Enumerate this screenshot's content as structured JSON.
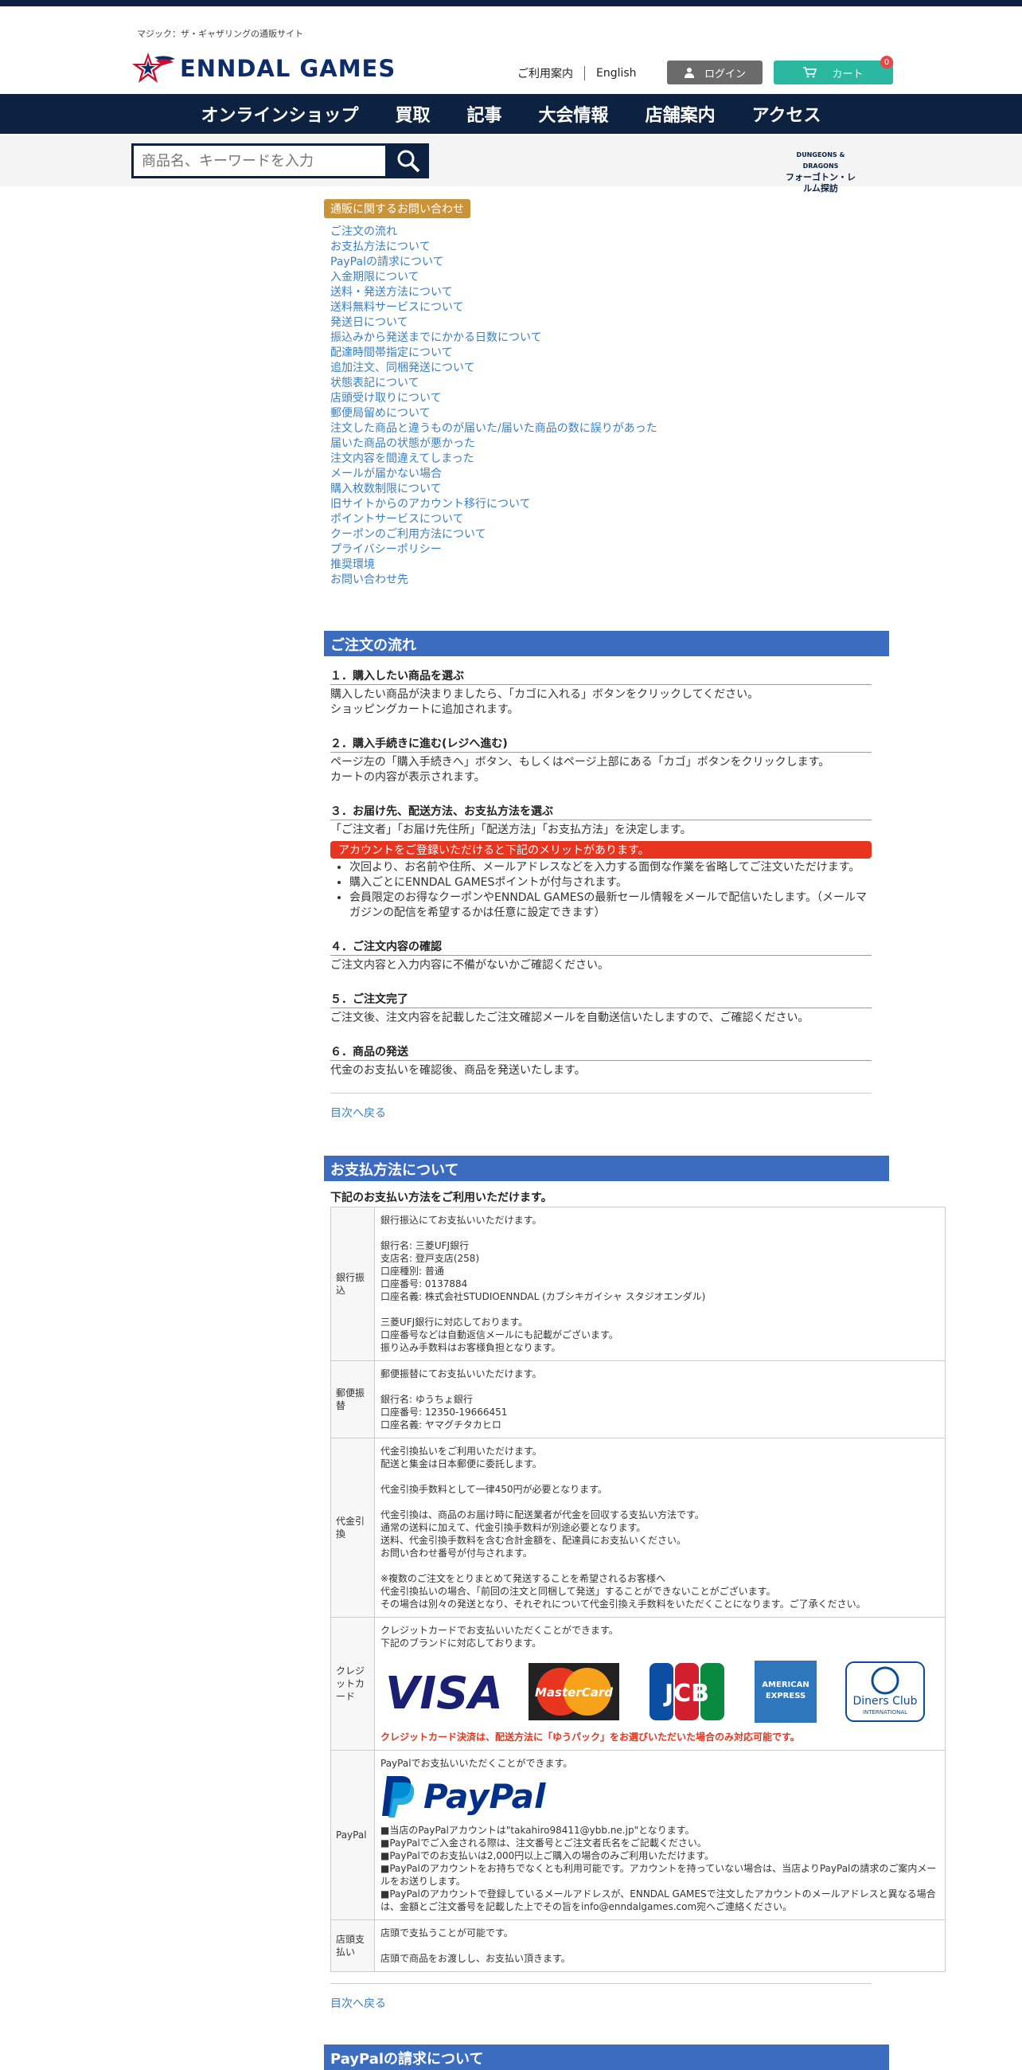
{
  "header": {
    "tagline": "マジック：ザ・ギャザリングの通販サイト",
    "logo_text": "ENNDAL GAMES",
    "links": [
      "ご利用案内",
      "English"
    ],
    "login_label": "ログイン",
    "cart_label": "カート",
    "cart_count": "0"
  },
  "nav": [
    "オンラインショップ",
    "買取",
    "記事",
    "大会情報",
    "店舗案内",
    "アクセス"
  ],
  "search": {
    "placeholder": "商品名、キーワードを入力"
  },
  "banner": {
    "top": "DUNGEONS & DRAGONS",
    "bottom": "フォーゴトン・レルム探訪"
  },
  "faq": {
    "tag": "通販に関するお問い合わせ",
    "toc": [
      "ご注文の流れ",
      "お支払方法について",
      "PayPalの請求について",
      "入金期限について",
      "送料・発送方法について",
      "送料無料サービスについて",
      "発送日について",
      "振込みから発送までにかかる日数について",
      "配達時間帯指定について",
      "追加注文、同梱発送について",
      "状態表記について",
      "店頭受け取りについて",
      "郵便局留めについて",
      "注文した商品と違うものが届いた/届いた商品の数に誤りがあった",
      "届いた商品の状態が悪かった",
      "注文内容を間違えてしまった",
      "メールが届かない場合",
      "購入枚数制限について",
      "旧サイトからのアカウント移行について",
      "ポイントサービスについて",
      "クーポンのご利用方法について",
      "プライバシーポリシー",
      "推奨環境",
      "お問い合わせ先"
    ]
  },
  "order_flow": {
    "title": "ご注文の流れ",
    "steps": [
      {
        "title": "１．購入したい商品を選ぶ",
        "lines": [
          "購入したい商品が決まりましたら、「カゴに入れる」ボタンをクリックしてください。",
          "ショッピングカートに追加されます。"
        ]
      },
      {
        "title": "２．購入手続きに進む(レジへ進む)",
        "lines": [
          "ページ左の「購入手続きへ」ボタン、もしくはページ上部にある「カゴ」ボタンをクリックします。",
          "カートの内容が表示されます。"
        ]
      },
      {
        "title": "３．お届け先、配送方法、お支払方法を選ぶ",
        "lines": [
          "「ご注文者」「お届け先住所」「配送方法」「お支払方法」を決定します。"
        ]
      },
      {
        "title": "４．ご注文内容の確認",
        "lines": [
          "ご注文内容と入力内容に不備がないかご確認ください。"
        ]
      },
      {
        "title": "５．ご注文完了",
        "lines": [
          "ご注文後、注文内容を記載したご注文確認メールを自動送信いたしますので、ご確認ください。"
        ]
      },
      {
        "title": "６．商品の発送",
        "lines": [
          "代金のお支払いを確認後、商品を発送いたします。"
        ]
      }
    ],
    "notice": "アカウントをご登録いただけると下記のメリットがあります。",
    "merits": [
      "次回より、お名前や住所、メールアドレスなどを入力する面倒な作業を省略してご注文いただけます。",
      "購入ごとにENNDAL GAMESポイントが付与されます。",
      "会員限定のお得なクーポンやENNDAL GAMESの最新セール情報をメールで配信いたします。（メールマガジンの配信を希望するかは任意に設定できます）"
    ],
    "back": "目次へ戻る"
  },
  "payment": {
    "title": "お支払方法について",
    "intro": "下記のお支払い方法をご利用いただけます。",
    "bank": {
      "label": "銀行振込",
      "lines": [
        "銀行振込にてお支払いいただけます。",
        "",
        "銀行名: 三菱UFJ銀行",
        "支店名: 登戸支店(258)",
        "口座種別: 普通",
        "口座番号: 0137884",
        "口座名義: 株式会社STUDIOENNDAL (カブシキガイシャ スタジオエンダル)",
        "",
        "三菱UFJ銀行に対応しております。",
        "口座番号などは自動返信メールにも記載がございます。",
        "振り込み手数料はお客様負担となります。"
      ]
    },
    "postal": {
      "label": "郵便振替",
      "lines": [
        "郵便振替にてお支払いいただけます。",
        "",
        "銀行名: ゆうちょ銀行",
        "口座番号: 12350-19666451",
        "口座名義: ヤマグチタカヒロ"
      ]
    },
    "cod": {
      "label": "代金引換",
      "lines": [
        "代金引換払いをご利用いただけます。",
        "配送と集金は日本郵便に委託します。",
        "",
        "代金引換手数料として一律450円が必要となります。",
        "",
        "代金引換は、商品のお届け時に配送業者が代金を回収する支払い方法です。",
        "通常の送料に加えて、代金引換手数料が別途必要となります。",
        "送料、代金引換手数料を含む合計金額を、配達員にお支払いください。",
        "お問い合わせ番号が付与されます。",
        "",
        "※複数のご注文をとりまとめて発送することを希望されるお客様へ",
        "代金引換払いの場合、「前回の注文と同梱して発送」することができないことがございます。",
        "その場合は別々の発送となり、それぞれについて代金引換え手数料をいただくことになります。ご了承ください。"
      ]
    },
    "credit": {
      "label": "クレジットカード",
      "lines": [
        "クレジットカードでお支払いいただくことができます。",
        "下記のブランドに対応しております。"
      ],
      "brands": [
        "VISA",
        "MasterCard",
        "JCB",
        "AMERICAN EXPRESS",
        "Diners Club"
      ],
      "diners_sub": "INTERNATIONAL",
      "warning": "クレジットカード決済は、配送方法に「ゆうパック」をお選びいただいた場合のみ対応可能です。"
    },
    "paypal": {
      "label": "PayPal",
      "intro": "PayPalでお支払いいただくことができます。",
      "logo_text": "PayPal",
      "lines": [
        "■当店のPayPalアカウントは\"takahiro98411@ybb.ne.jp\"となります。",
        "■PayPalでご入金される際は、注文番号とご注文者氏名をご記載ください。",
        "■PayPalでのお支払いは2,000円以上ご購入の場合のみご利用いただけます。",
        "■PayPalのアカウントをお持ちでなくとも利用可能です。アカウントを持っていない場合は、当店よりPayPalの請求のご案内メールをお送りします。",
        "■PayPalのアカウントで登録しているメールアドレスが、ENNDAL GAMESで注文したアカウントのメールアドレスと異なる場合は、金額とご注文番号を記載した上でその旨をinfo@enndalgames.com宛へご連絡ください。"
      ]
    },
    "store": {
      "label": "店頭支払い",
      "lines": [
        "店頭で支払うことが可能です。",
        "",
        "店頭で商品をお渡しし、お支払い頂きます。"
      ]
    },
    "back": "目次へ戻る"
  },
  "next_section": {
    "title": "PayPalの請求について"
  },
  "colors": {
    "navy": "#0d2240",
    "accent_teal": "#2bb8a0",
    "section_blue": "#3b6cc0",
    "link_blue": "#3a80c2",
    "notice_red": "#e8351f"
  }
}
